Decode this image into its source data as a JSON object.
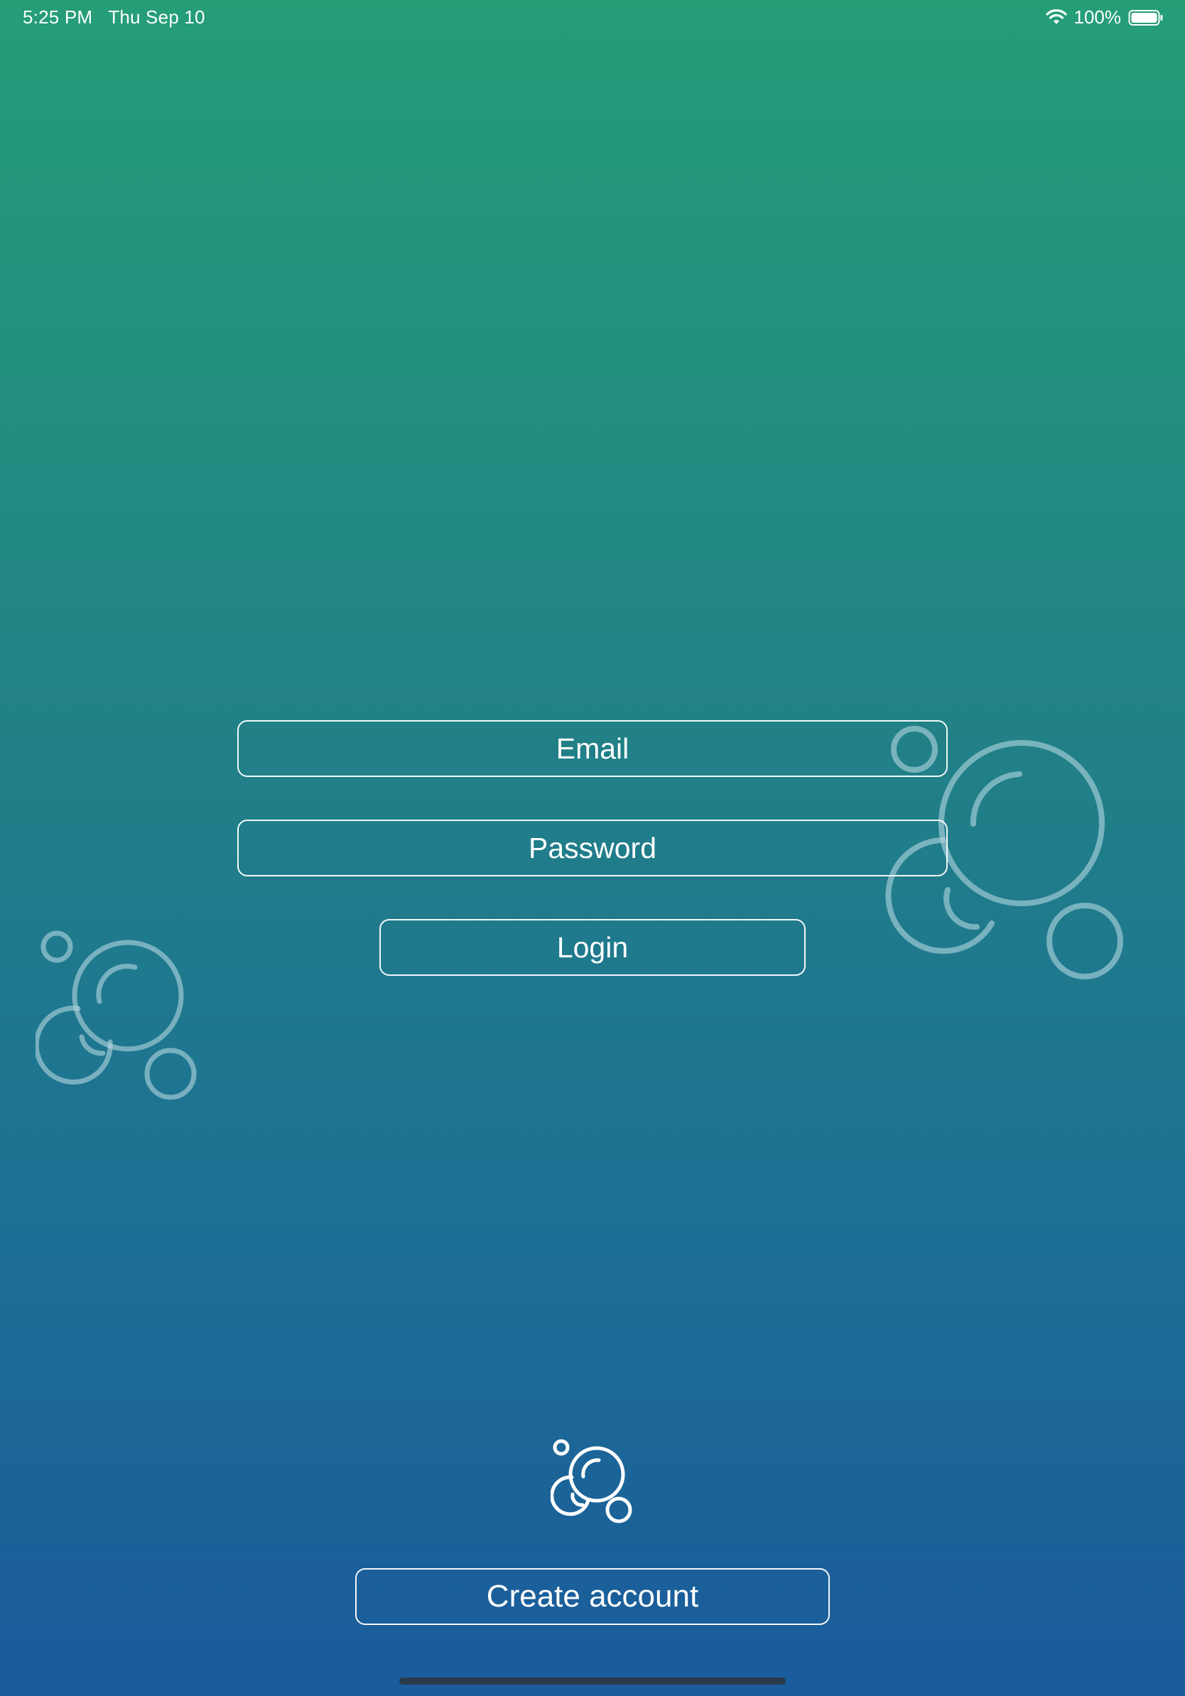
{
  "status_bar": {
    "time": "5:25 PM",
    "date": "Thu Sep 10",
    "battery_percent": "100%",
    "icons": [
      "wifi-icon",
      "battery-icon"
    ]
  },
  "login_form": {
    "email_placeholder": "Email",
    "password_placeholder": "Password",
    "login_label": "Login"
  },
  "footer": {
    "logo_icon": "bubbles-logo-icon",
    "create_account_label": "Create account"
  },
  "decorations": [
    "bubbles-icon",
    "bubbles-icon"
  ],
  "colors": {
    "gradient_top": "#259e78",
    "gradient_bottom": "#1a5b9c",
    "text": "#ffffff",
    "decoration": "rgba(180,215,225,0.6)"
  }
}
